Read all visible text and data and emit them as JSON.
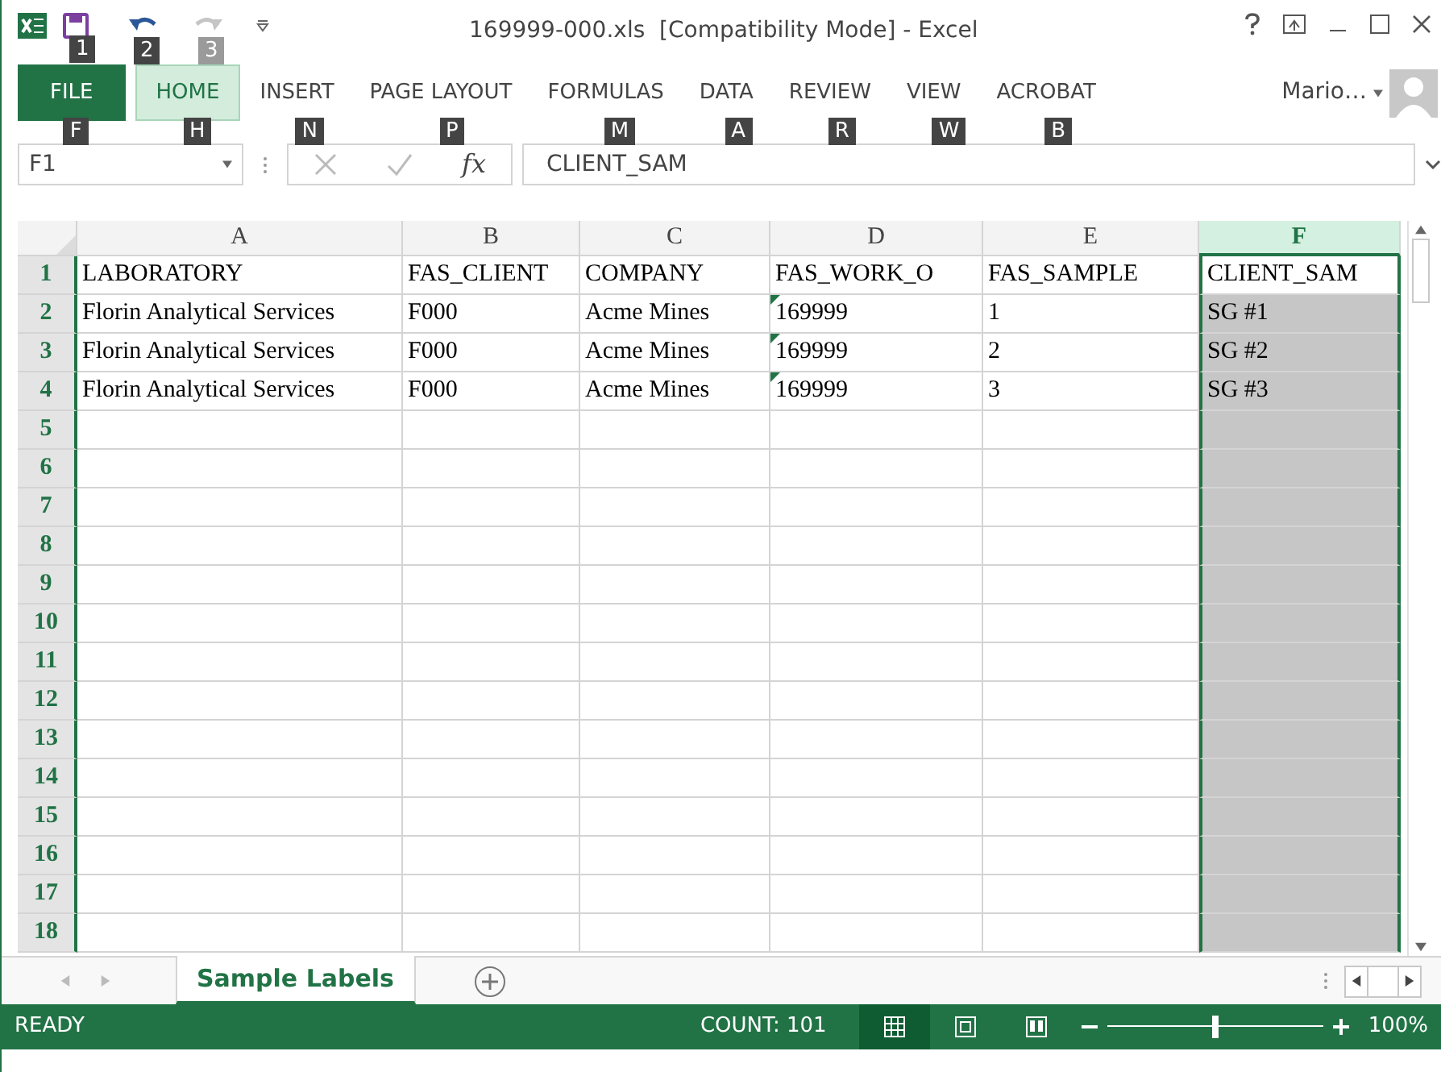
{
  "window": {
    "title": "169999-000.xls  [Compatibility Mode] - Excel",
    "user": "Mario…"
  },
  "quick_access": [
    {
      "kind": "save",
      "keytip": "1",
      "disabled": false
    },
    {
      "kind": "undo",
      "keytip": "2",
      "disabled": false
    },
    {
      "kind": "redo",
      "keytip": "3",
      "disabled": true
    }
  ],
  "ribbon_tabs": [
    {
      "label": "FILE",
      "keytip": "F",
      "selected": false,
      "kind": "file"
    },
    {
      "label": "HOME",
      "keytip": "H",
      "selected": true,
      "kind": "tab"
    },
    {
      "label": "INSERT",
      "keytip": "N",
      "selected": false,
      "kind": "tab"
    },
    {
      "label": "PAGE LAYOUT",
      "keytip": "P",
      "selected": false,
      "kind": "tab"
    },
    {
      "label": "FORMULAS",
      "keytip": "M",
      "selected": false,
      "kind": "tab"
    },
    {
      "label": "DATA",
      "keytip": "A",
      "selected": false,
      "kind": "tab"
    },
    {
      "label": "REVIEW",
      "keytip": "R",
      "selected": false,
      "kind": "tab"
    },
    {
      "label": "VIEW",
      "keytip": "W",
      "selected": false,
      "kind": "tab"
    },
    {
      "label": "ACROBAT",
      "keytip": "B",
      "selected": false,
      "kind": "tab"
    }
  ],
  "formula_bar": {
    "name_box": "F1",
    "fx": "fx",
    "value": "CLIENT_SAM"
  },
  "columns": [
    {
      "label": "A",
      "selected": false
    },
    {
      "label": "B",
      "selected": false
    },
    {
      "label": "C",
      "selected": false
    },
    {
      "label": "D",
      "selected": false
    },
    {
      "label": "E",
      "selected": false
    },
    {
      "label": "F",
      "selected": true
    }
  ],
  "rows": [
    {
      "number": "1",
      "cells": [
        {
          "text": "LABORATORY",
          "flagged": false
        },
        {
          "text": "FAS_CLIENT",
          "flagged": false
        },
        {
          "text": "COMPANY",
          "flagged": false
        },
        {
          "text": "FAS_WORK_O",
          "flagged": false
        },
        {
          "text": "FAS_SAMPLE",
          "flagged": false
        },
        {
          "text": "CLIENT_SAM",
          "flagged": false
        }
      ]
    },
    {
      "number": "2",
      "cells": [
        {
          "text": "Florin Analytical Services",
          "flagged": false
        },
        {
          "text": "F000",
          "flagged": false
        },
        {
          "text": "Acme Mines",
          "flagged": false
        },
        {
          "text": "169999",
          "flagged": true
        },
        {
          "text": "1",
          "flagged": false
        },
        {
          "text": "SG #1",
          "flagged": false
        }
      ]
    },
    {
      "number": "3",
      "cells": [
        {
          "text": "Florin Analytical Services",
          "flagged": false
        },
        {
          "text": "F000",
          "flagged": false
        },
        {
          "text": "Acme Mines",
          "flagged": false
        },
        {
          "text": "169999",
          "flagged": true
        },
        {
          "text": "2",
          "flagged": false
        },
        {
          "text": "SG #2",
          "flagged": false
        }
      ]
    },
    {
      "number": "4",
      "cells": [
        {
          "text": "Florin Analytical Services",
          "flagged": false
        },
        {
          "text": "F000",
          "flagged": false
        },
        {
          "text": "Acme Mines",
          "flagged": false
        },
        {
          "text": "169999",
          "flagged": true
        },
        {
          "text": "3",
          "flagged": false
        },
        {
          "text": "SG #3",
          "flagged": false
        }
      ]
    },
    {
      "number": "5"
    },
    {
      "number": "6"
    },
    {
      "number": "7"
    },
    {
      "number": "8"
    },
    {
      "number": "9"
    },
    {
      "number": "10"
    },
    {
      "number": "11"
    },
    {
      "number": "12"
    },
    {
      "number": "13"
    },
    {
      "number": "14"
    },
    {
      "number": "15"
    },
    {
      "number": "16"
    },
    {
      "number": "17"
    },
    {
      "number": "18"
    }
  ],
  "sheet_tabs": [
    {
      "label": "Sample Labels",
      "selected": true
    }
  ],
  "status_bar": {
    "status": "READY",
    "count": "COUNT: 101",
    "views": [
      {
        "kind": "normal",
        "selected": true
      },
      {
        "kind": "page_layout",
        "selected": false
      },
      {
        "kind": "page_break",
        "selected": false
      }
    ],
    "zoom": {
      "level": 0.5,
      "reading": "100%"
    }
  }
}
